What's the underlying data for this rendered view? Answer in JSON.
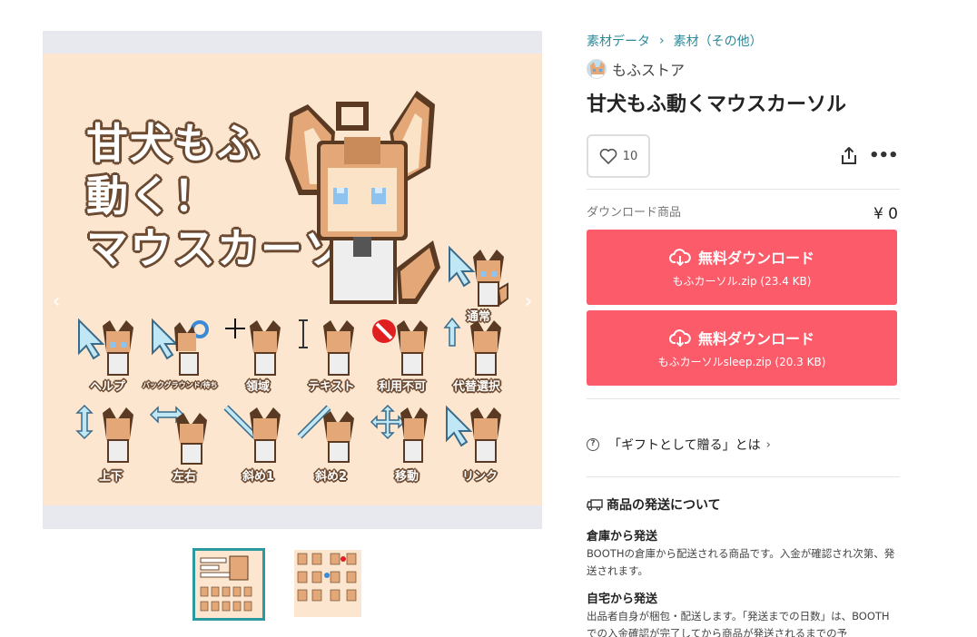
{
  "gallery": {
    "nav_prev": "‹",
    "nav_next": "›",
    "hero_lines": [
      "甘犬もふ",
      "動く！",
      "マウスカーソル"
    ],
    "cursor_labels": {
      "normal": "通常",
      "help": "ヘルプ",
      "background": "バックグラウンド/待ち",
      "area": "領域",
      "text": "テキスト",
      "unavailable": "利用不可",
      "alternate": "代替選択",
      "vertical": "上下",
      "horizontal": "左右",
      "diagonal1": "斜め1",
      "diagonal2": "斜め2",
      "move": "移動",
      "link": "リンク"
    },
    "colors": {
      "background": "#fce6cf",
      "frame": "#e7e9ee",
      "outline": "#6b4a31",
      "active_thumb_border": "#2b9aa0"
    }
  },
  "breadcrumb": [
    "素材データ",
    "素材（その他）"
  ],
  "shop": {
    "name": "もふストア",
    "avatar_icon": "shop-avatar"
  },
  "item": {
    "title": "甘犬もふ動くマウスカーソル"
  },
  "actions": {
    "like_count": "10",
    "like_icon": "heart-icon",
    "share_icon": "share-icon",
    "more_icon": "more-icon",
    "more_label": "•••"
  },
  "download": {
    "label": "ダウンロード商品",
    "price": "¥ 0",
    "button_color": "#fc5b6a",
    "buttons": [
      {
        "label": "無料ダウンロード",
        "file": "もふカーソル.zip (23.4 KB)"
      },
      {
        "label": "無料ダウンロード",
        "file": "もふカーソルsleep.zip (20.3 KB)"
      }
    ]
  },
  "gift": {
    "text": "「ギフトとして贈る」とは",
    "chevron": "›",
    "q": "?"
  },
  "shipping": {
    "heading": "商品の発送について",
    "warehouse_title": "倉庫から発送",
    "warehouse_text": "BOOTHの倉庫から配送される商品です。入金が確認され次第、発送されます。",
    "home_title": "自宅から発送",
    "home_text": "出品者自身が梱包・配送します。「発送までの日数」は、BOOTHでの入金確認が完了してから商品が発送されるまでの予"
  }
}
